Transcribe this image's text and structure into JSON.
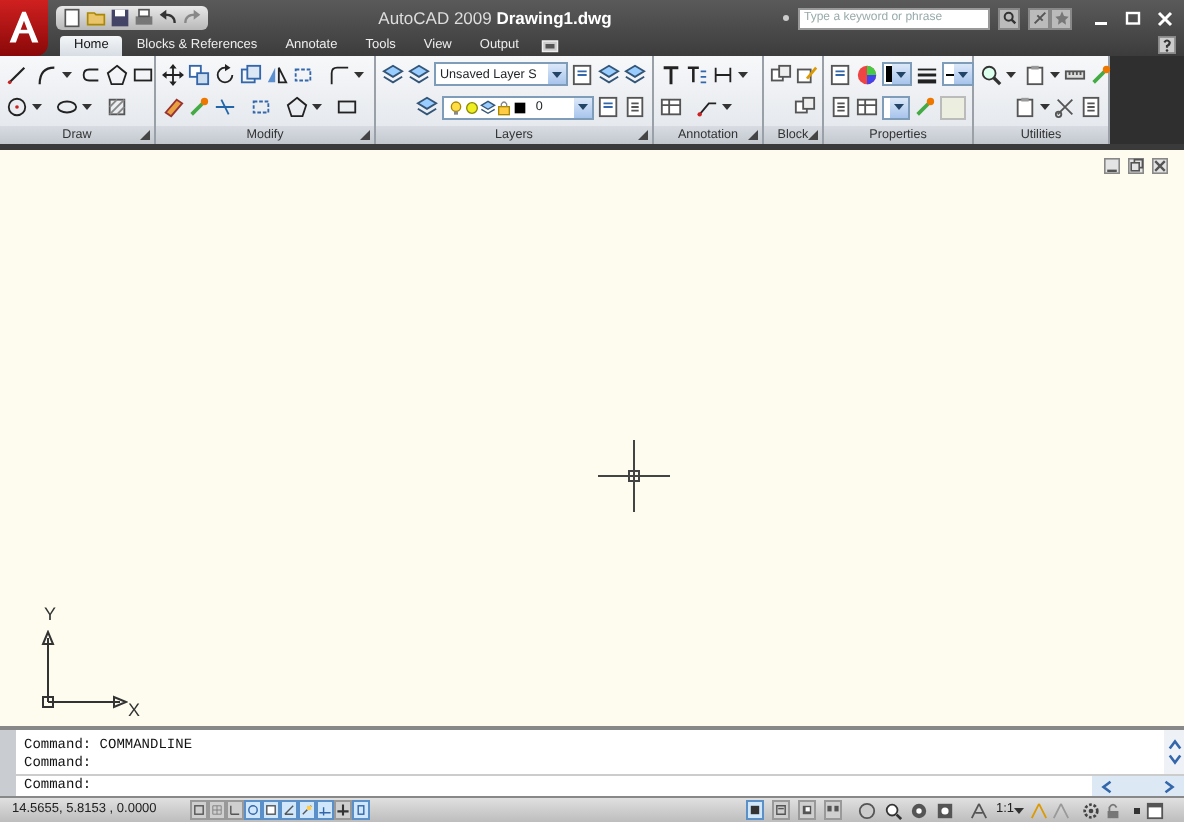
{
  "title_bar": {
    "title": "AutoCAD 2009 **Drawing1.dwg**",
    "search": {
      "placeholder": "Type a keyword or phrase"
    }
  },
  "tabs": [
    {
      "label": "Home",
      "selected": true
    },
    {
      "label": "Blocks & References",
      "selected": false
    },
    {
      "label": "Annotate",
      "selected": false
    },
    {
      "label": "Tools",
      "selected": false
    },
    {
      "label": "View",
      "selected": false
    },
    {
      "label": "Output",
      "selected": false
    }
  ],
  "ribbon": {
    "panels": [
      {
        "label": "Draw",
        "launcher": true
      },
      {
        "label": "Modify",
        "launcher": true
      },
      {
        "label": "Layers",
        "launcher": true
      },
      {
        "label": "Annotation",
        "launcher": true
      },
      {
        "label": "Block",
        "launcher": true
      },
      {
        "label": "Properties",
        "launcher": false
      },
      {
        "label": "Utilities",
        "launcher": false
      }
    ],
    "layer_state": "Unsaved Layer S",
    "current_layer": "0"
  },
  "ucs": {
    "y_label": "Y",
    "x_label": "X"
  },
  "command_lines": [
    "Command: COMMANDLINE",
    "Command:"
  ],
  "command_prompt": "Command:",
  "status_bar": {
    "coordinates": "14.5655, 5.8153 , 0.0000",
    "toggles": [
      {
        "on": false
      },
      {
        "on": false
      },
      {
        "on": false
      },
      {
        "on": true
      },
      {
        "on": true
      },
      {
        "on": true
      },
      {
        "on": true
      },
      {
        "on": true
      },
      {
        "on": false
      },
      {
        "on": true
      }
    ],
    "layout_buttons": [
      {
        "selected": true
      },
      {
        "selected": false
      },
      {
        "selected": false
      },
      {
        "selected": false
      }
    ],
    "annotation_scale": "1:1"
  }
}
